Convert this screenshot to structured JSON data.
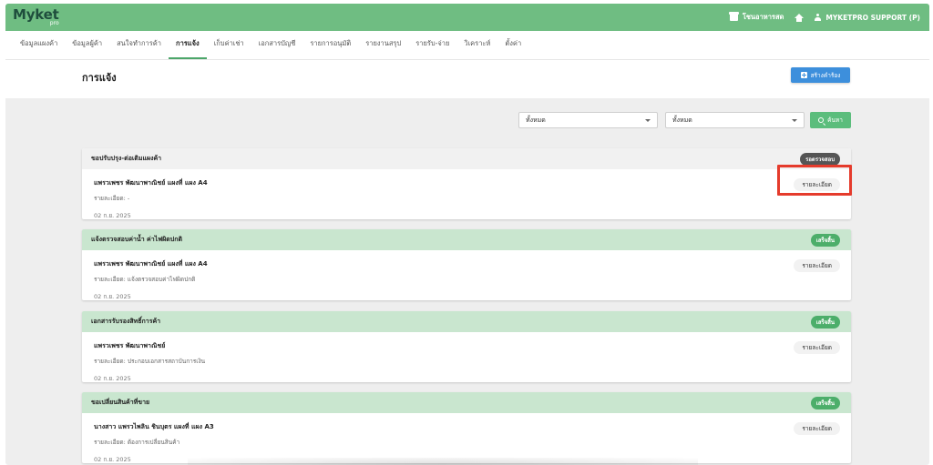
{
  "app": {
    "logo_main": "Myket",
    "logo_sub": "pro",
    "store_label": "โชนอาหารสด",
    "user_label": "MYKETPRO SUPPORT (P)"
  },
  "nav": {
    "tabs": [
      {
        "label": "ข้อมูลแผงค้า",
        "active": false
      },
      {
        "label": "ข้อมูลผู้ค้า",
        "active": false
      },
      {
        "label": "สนใจทำการค้า",
        "active": false
      },
      {
        "label": "การแจ้ง",
        "active": true
      },
      {
        "label": "เก็บค่าเช่า",
        "active": false
      },
      {
        "label": "เอกสารบัญชี",
        "active": false
      },
      {
        "label": "รายการอนุมัติ",
        "active": false
      },
      {
        "label": "รายงานสรุป",
        "active": false
      },
      {
        "label": "รายรับ-จ่าย",
        "active": false
      },
      {
        "label": "วิเคราะห์",
        "active": false
      },
      {
        "label": "ตั้งค่า",
        "active": false
      }
    ]
  },
  "page": {
    "title": "การแจ้ง",
    "create_button": "สร้างคำร้อง"
  },
  "filters": {
    "select1": "ทั้งหมด",
    "select2": "ทั้งหมด",
    "search_button": "ค้นหา"
  },
  "colors": {
    "topbar": "#6fbd82",
    "accent_blue": "#3d8fdc",
    "badge_done": "#4cae6a",
    "badge_pending": "#555555",
    "highlight": "#e53b2c"
  },
  "cards": [
    {
      "title": "ขอปรับปรุง-ต่อเติมแผงค้า",
      "status": "รอตรวจสอบ",
      "status_type": "pending",
      "shop": "แพรวเพชร พัฒนาพาณิชย์ แผงที่ แผง A4",
      "detail": "รายละเอียด: -",
      "date": "02 ก.ย. 2025",
      "button": "รายละเอียด"
    },
    {
      "title": "แจ้งตรวจสอบค่าน้ำ ค่าไฟผิดปกติ",
      "status": "เสร็จสิ้น",
      "status_type": "done",
      "shop": "แพรวเพชร พัฒนาพาณิชย์ แผงที่ แผง A4",
      "detail": "รายละเอียด: แจ้งตรวจสอบค่าไฟผิดปกติ",
      "date": "02 ก.ย. 2025",
      "button": "รายละเอียด"
    },
    {
      "title": "เอกสารรับรองสิทธิ์การค้า",
      "status": "เสร็จสิ้น",
      "status_type": "done",
      "shop": "แพรวเพชร พัฒนาพาณิชย์",
      "detail": "รายละเอียด: ประกอบเอกสารสถาบันการเงิน",
      "date": "02 ก.ย. 2025",
      "button": "รายละเอียด"
    },
    {
      "title": "ขอเปลี่ยนสินค้าที่ขาย",
      "status": "เสร็จสิ้น",
      "status_type": "done",
      "shop": "นางสาว แพรวไพลิน ชินบุตร แผงที่ แผง A3",
      "detail": "รายละเอียด: ต้องการเปลี่ยนสินค้า",
      "date": "02 ก.ย. 2025",
      "button": "รายละเอียด"
    }
  ]
}
